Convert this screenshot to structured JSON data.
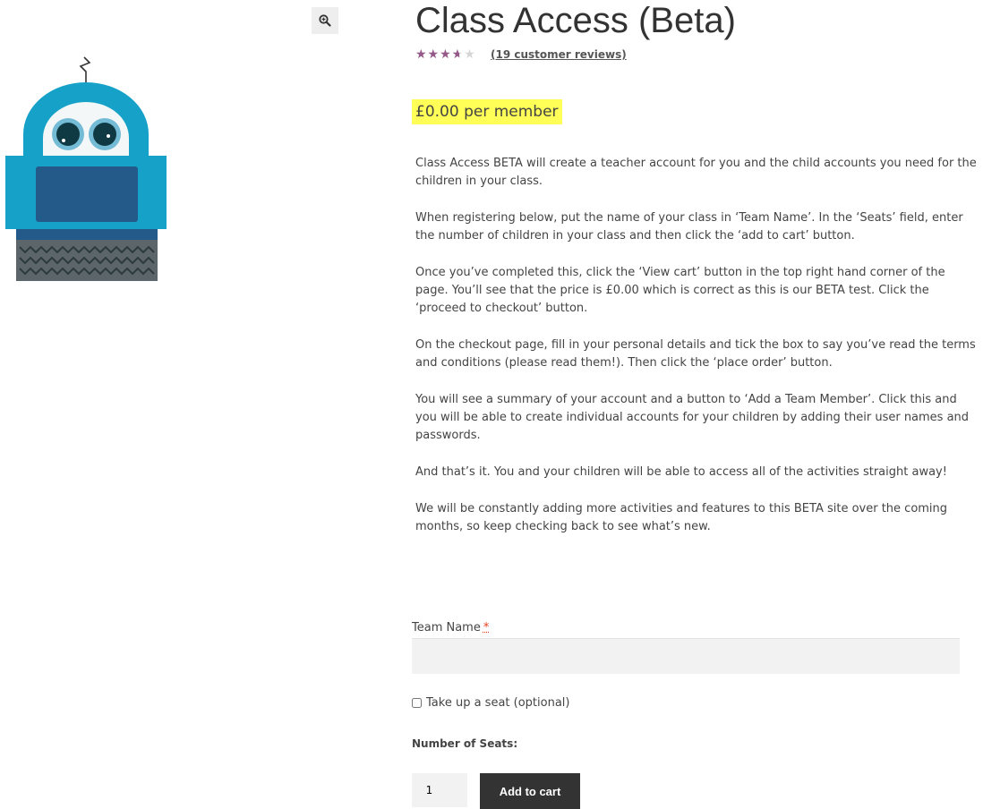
{
  "product": {
    "title": "Class Access (Beta)",
    "rating": {
      "stars_text": "★★★★★",
      "value_fraction": 0.64,
      "reviews_link": "(19 customer reviews)"
    },
    "price": "£0.00 per member",
    "description": [
      "Class Access BETA will create a teacher account for you and the child accounts you need for the children in your class.",
      "When registering below, put the name of your class in ‘Team Name’. In the ‘Seats’ field, enter the number of children in your class and then click the ‘add to cart’ button.",
      "Once you’ve completed this, click the ‘View cart’ button in the top right hand corner of the page. You’ll see that the price is £0.00 which is correct as this is our BETA test. Click the ‘proceed to checkout’ button.",
      "On the checkout page, fill in your personal details and tick the box to say you’ve read the terms and conditions (please read them!). Then click the ‘place order’ button.",
      "You will see a summary of your account and a button to ‘Add a Team Member’. Click this and you will be able to create individual accounts for your children by adding their user names and passwords.",
      "And that’s it. You and your children will be able to access all of the activities straight away!",
      "We will be constantly adding more activities and features to this BETA site over the coming months, so keep checking back to see what’s new."
    ]
  },
  "form": {
    "team_name_label": "Team Name",
    "required_marker": "*",
    "team_name_value": "",
    "take_seat_label": "Take up a seat (optional)",
    "take_seat_checked": false,
    "seats_label": "Number of Seats:",
    "quantity": "1",
    "add_to_cart": "Add to cart"
  },
  "icons": {
    "zoom": "magnifier-plus-icon",
    "image": "robot-illustration"
  },
  "colors": {
    "star": "#96588a",
    "price_highlight": "#ffff58",
    "button": "#333333"
  }
}
